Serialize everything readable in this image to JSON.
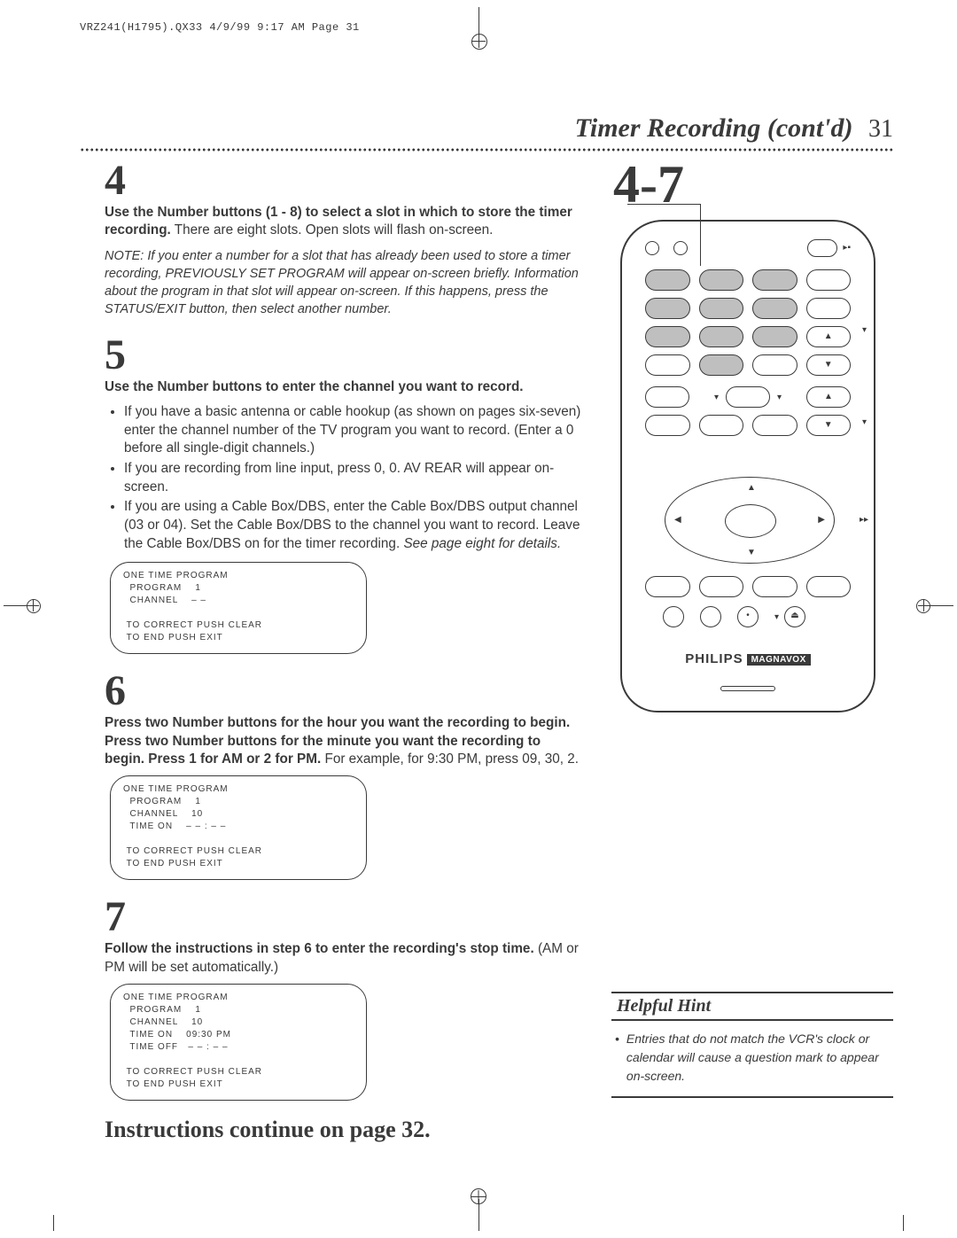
{
  "print_header": "VRZ241(H1795).QX33  4/9/99 9:17 AM  Page 31",
  "title": "Timer Recording (cont'd)",
  "page_number": "31",
  "steps_heading_right": "4-7",
  "step4": {
    "num": "4",
    "bold": "Use the Number buttons (1 - 8) to select a slot in which to store the timer recording.",
    "rest": " There are eight slots. Open slots will flash on-screen.",
    "note": "NOTE: If you enter a number for a slot that has already been used to store a timer recording, PREVIOUSLY SET PROGRAM will appear on-screen briefly. Information about the program in that slot will appear on-screen. If this happens, press the STATUS/EXIT button, then select another number."
  },
  "step5": {
    "num": "5",
    "bold": "Use the Number buttons to enter the channel you want to record.",
    "bullets": [
      "If you have a basic antenna or cable hookup (as shown on pages six-seven) enter the channel number of the TV program you want to record. (Enter a 0 before all single-digit channels.)",
      "If you are recording from line input, press 0, 0. AV REAR will appear on-screen.",
      "If you are using a Cable Box/DBS, enter the Cable Box/DBS output channel (03 or 04). Set the Cable Box/DBS to the channel you want to record. Leave the Cable Box/DBS on for the timer recording."
    ],
    "bullet3_tail": " See page eight for details.",
    "osd": {
      "l1": "ONE TIME PROGRAM",
      "l2": "  PROGRAM    1",
      "l3": "  CHANNEL    – –",
      "l4": " TO CORRECT PUSH CLEAR",
      "l5": " TO END PUSH EXIT"
    }
  },
  "step6": {
    "num": "6",
    "bold": "Press two Number buttons for the hour you want the recording to begin. Press two Number buttons for the minute you want the recording to begin. Press 1 for AM or 2 for PM.",
    "rest": " For example, for 9:30 PM, press 09, 30, 2.",
    "osd": {
      "l1": "ONE TIME PROGRAM",
      "l2": "  PROGRAM    1",
      "l3": "  CHANNEL    10",
      "l4": "  TIME ON    – – : – –",
      "l5": " TO CORRECT PUSH CLEAR",
      "l6": " TO END PUSH EXIT"
    }
  },
  "step7": {
    "num": "7",
    "bold": "Follow the instructions in step 6 to enter the recording's stop time.",
    "rest": " (AM or PM will be set automatically.)",
    "osd": {
      "l1": "ONE TIME PROGRAM",
      "l2": "  PROGRAM    1",
      "l3": "  CHANNEL    10",
      "l4": "  TIME ON    09:30 PM",
      "l5": "  TIME OFF   – – : – –",
      "l6": " TO CORRECT PUSH CLEAR",
      "l7": " TO END PUSH EXIT"
    }
  },
  "continue_text": "Instructions continue on page 32.",
  "remote": {
    "brand": "PHILIPS",
    "subbrand": "MAGNAVOX"
  },
  "hint": {
    "title": "Helpful Hint",
    "body": "Entries that do not match the VCR's clock or calendar will cause a question mark to appear on-screen."
  }
}
